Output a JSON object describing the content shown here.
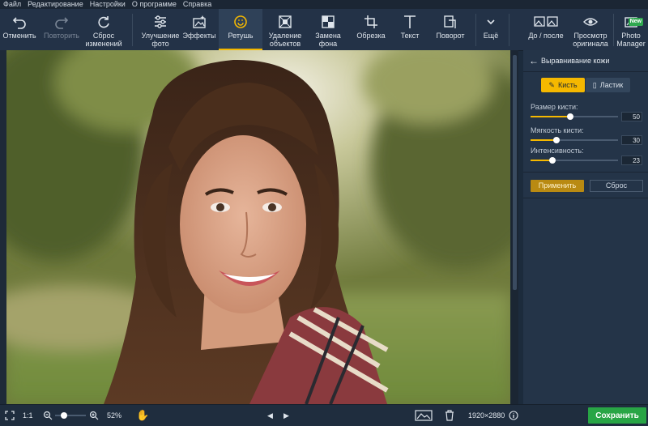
{
  "menu": [
    "Файл",
    "Редактирование",
    "Настройки",
    "О программе",
    "Справка"
  ],
  "toolbar": {
    "undo": "Отменить",
    "redo": "Повторить",
    "reset_changes": "Сброс изменений",
    "enhance": "Улучшение фото",
    "effects": "Эффекты",
    "retouch": "Ретушь",
    "remove_objects": "Удаление объектов",
    "replace_bg": "Замена фона",
    "crop": "Обрезка",
    "text": "Текст",
    "rotate": "Поворот",
    "more": "Ещё",
    "before_after": "До / после",
    "view_original": "Просмотр оригинала",
    "photo_manager": "Photo Manager",
    "new_badge": "New"
  },
  "panel": {
    "title": "Выравнивание кожи",
    "brush": "Кисть",
    "eraser": "Ластик",
    "sliders": [
      {
        "label": "Размер кисти:",
        "value": "50",
        "fraction": 0.45
      },
      {
        "label": "Мягкость кисти:",
        "value": "30",
        "fraction": 0.3
      },
      {
        "label": "Интенсивность:",
        "value": "23",
        "fraction": 0.25
      }
    ],
    "apply": "Применить",
    "reset": "Сброс"
  },
  "bottom": {
    "actual_size": "1:1",
    "zoom": "52%",
    "zoom_fraction": 0.3,
    "dimensions": "1920×2880",
    "save": "Сохранить"
  },
  "colors": {
    "accent": "#f5b800",
    "save": "#28a545",
    "toolbar": "#233247"
  }
}
